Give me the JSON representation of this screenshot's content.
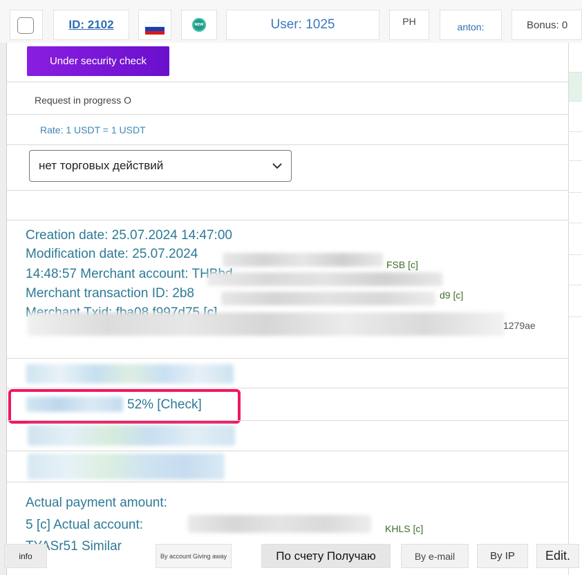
{
  "header": {
    "id_label": "ID: 2102",
    "new_badge": "NEW",
    "user_label": "User: 1025",
    "ph_label": "PH",
    "anton_label": "anton:",
    "bonus_label": "Bonus: 0"
  },
  "status": {
    "button_label": "Under security check",
    "request_text": "Request in progress O",
    "rate_text": "Rate: 1 USDT = 1 USDT"
  },
  "trade_select": {
    "value": "нет торговых действий"
  },
  "details": {
    "creation": "Creation date: 25.07.2024 14:47:00",
    "modification": "Modification date: 25.07.2024",
    "merchant_account": "14:48:57 Merchant account: THBbd",
    "merchant_account_suffix": "FSB [c]",
    "merchant_txn": "Merchant transaction ID: 2b8",
    "merchant_txn_suffix": "d9 [c]",
    "merchant_txid": "Merchant Txid: fba08 f997d75 [c]",
    "merchant_txid_suffix": "1279ae"
  },
  "check": {
    "percent_label": "52% [Check]"
  },
  "payment": {
    "actual_amount": "Actual payment amount:",
    "actual_account": "5 [c] Actual account:",
    "actual_account_suffix": "KHLS [c]",
    "similar": "TYASr51 Similar"
  },
  "bottom_bar": {
    "info": "info",
    "by_account": "By account Giving away",
    "by_account_receiving": "По счету Получаю",
    "by_email": "By e-mail",
    "by_ip": "By IP",
    "edit": "Edit."
  },
  "colors": {
    "accent_purple": "#7a16d6",
    "link_blue": "#2f6db3",
    "teal_text": "#2d7a96",
    "highlight_pink": "#f0175f"
  }
}
